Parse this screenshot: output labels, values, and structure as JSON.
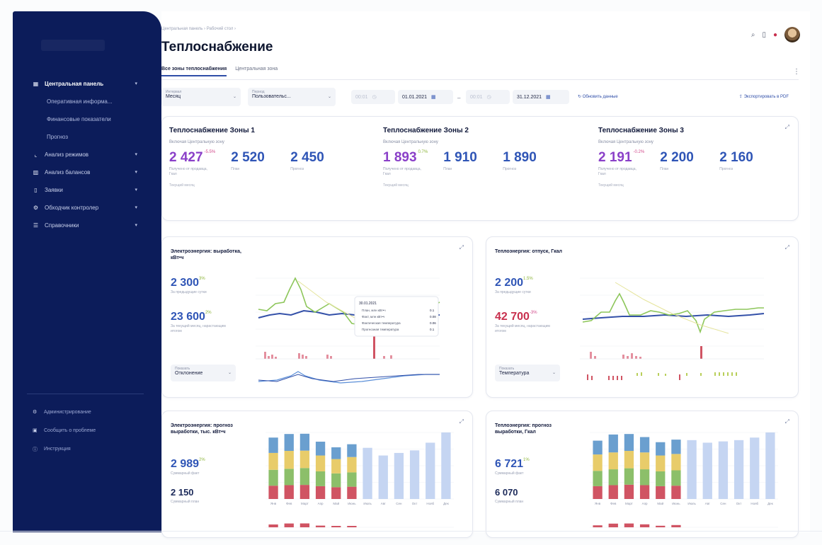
{
  "colors": {
    "sidebar": "#0c1c5a",
    "accent": "#2f55b6",
    "purple": "#8a3fc8",
    "red": "#c8304e",
    "green_line": "#7fc04a",
    "bar_red": "#d05463",
    "bar_green": "#8cbf6a",
    "bar_yellow": "#e8cc6a",
    "bar_blue": "#6a9fcf",
    "bar_forecast": "#c5d5f2"
  },
  "sidebar": {
    "items": [
      {
        "label": "Центральная панель",
        "icon": "grid-icon"
      },
      {
        "label": "Оперативная информа..."
      },
      {
        "label": "Финансовые показатели"
      },
      {
        "label": "Прогноз"
      },
      {
        "label": "Анализ режимов",
        "icon": "chart-line-icon"
      },
      {
        "label": "Анализ балансов",
        "icon": "chart-bar-icon"
      },
      {
        "label": "Заявки",
        "icon": "document-icon"
      },
      {
        "label": "Обходчик контролер",
        "icon": "gear-icon"
      },
      {
        "label": "Справочники",
        "icon": "list-icon"
      }
    ],
    "footer": [
      {
        "label": "Администрирование",
        "icon": "settings-icon"
      },
      {
        "label": "Сообщить о проблеме",
        "icon": "message-icon"
      },
      {
        "label": "Инструкция",
        "icon": "info-icon"
      }
    ]
  },
  "header": {
    "breadcrumb": "Центральная панель  ›  Рабочий стол  ›",
    "title": "Теплоснабжение",
    "tabs": [
      "Все зоны теплоснабжения",
      "Центральная зона"
    ]
  },
  "filters": {
    "interval_label": "Интервал",
    "interval_value": "Месяц",
    "period_label": "Период",
    "period_value": "Пользовательс...",
    "time_from": "00:01",
    "date_from": "01.01.2021",
    "time_to": "00:01",
    "date_to": "31.12.2021",
    "refresh": "Обновить данные",
    "export": "Экспортировать в PDF"
  },
  "zones": [
    {
      "title": "Теплоснабжение Зоны 1",
      "subtitle": "Включая Центральную зону",
      "value": "2 427",
      "delta": "-5.5%",
      "value_label": "Получено от продавца, Гкал",
      "plan": "2 520",
      "plan_label": "План",
      "forecast": "2 450",
      "forecast_label": "Прогноз",
      "footer": "Текущий месяц"
    },
    {
      "title": "Теплоснабжение Зоны 2",
      "subtitle": "Включая Центральную зону",
      "value": "1 893",
      "delta": "0.7%",
      "value_label": "Получено от продавца, Гкал",
      "plan": "1 910",
      "plan_label": "План",
      "forecast": "1 890",
      "forecast_label": "Прогноз",
      "footer": "Текущий месяц"
    },
    {
      "title": "Теплоснабжение Зоны 3",
      "subtitle": "Включая Центральную зону",
      "value": "2 191",
      "delta": "-0.2%",
      "value_label": "Получено от продавца, Гкал",
      "plan": "2 200",
      "plan_label": "План",
      "forecast": "2 160",
      "forecast_label": "Прогноз",
      "footer": "Текущий месяц"
    }
  ],
  "panels": {
    "elec_output": {
      "title": "Электроэнергия: выработка, кВт•ч",
      "kpi1": "2 300",
      "kpi1_delta": "3%",
      "kpi1_label": "За предыдущие сутки",
      "kpi2": "23 600",
      "kpi2_delta": "2%",
      "kpi2_label": "За текущий месяц, нарастающим итогом",
      "select_label": "Показать",
      "select_value": "Отклонение",
      "tooltip": {
        "date": "30.01.2021",
        "rows": [
          {
            "label": "План, млн кВт•ч",
            "value": "0.1"
          },
          {
            "label": "Факт, млн кВт•ч",
            "value": "0.08"
          },
          {
            "label": "Фактическая температура",
            "value": "0.06"
          },
          {
            "label": "Прогнозная температура",
            "value": "0.1"
          }
        ]
      }
    },
    "heat_release": {
      "title": "Теплоэнергия: отпуск, Гкал",
      "kpi1": "2 200",
      "kpi1_delta": "1.5%",
      "kpi1_label": "За предыдущие сутки",
      "kpi2": "42 700",
      "kpi2_delta": "-3%",
      "kpi2_label": "За текущий месяц, нарастающим итогом",
      "select_label": "Показать",
      "select_value": "Температура"
    },
    "elec_forecast": {
      "title": "Электроэнергия: прогноз выработки, тыс. кВт•ч",
      "kpi1": "2 989",
      "kpi1_delta": "2%",
      "kpi1_label": "Суммарный факт",
      "kpi2": "2 150",
      "kpi2_label": "Суммарный план"
    },
    "heat_forecast": {
      "title": "Теплоэнергия: прогноз выработки, Гкал",
      "kpi1": "6 721",
      "kpi1_delta": "1%",
      "kpi1_label": "Суммарный факт",
      "kpi2": "6 070",
      "kpi2_label": "Суммарный план"
    }
  },
  "chart_data": [
    {
      "type": "bar",
      "title": "",
      "categories": [
        "Янв",
        "Фев",
        "Март",
        "Апр",
        "Май",
        "Июнь",
        "Июль",
        "Авг",
        "Сен",
        "Окт",
        "Нояб",
        "Дек"
      ],
      "series": [
        {
          "values": [
            52,
            54,
            55,
            50,
            46,
            48,
            0,
            0,
            0,
            0,
            0,
            0
          ]
        },
        {
          "values": [
            62,
            64,
            66,
            58,
            54,
            56,
            0,
            0,
            0,
            0,
            0,
            0
          ]
        },
        {
          "values": [
            66,
            70,
            68,
            62,
            56,
            60,
            0,
            0,
            0,
            0,
            0,
            0
          ]
        },
        {
          "values": [
            60,
            66,
            66,
            54,
            46,
            50,
            0,
            0,
            0,
            0,
            0,
            0
          ]
        },
        {
          "values": [
            0,
            0,
            0,
            0,
            0,
            0,
            200,
            170,
            180,
            190,
            220,
            260
          ]
        }
      ]
    },
    {
      "type": "bar",
      "title": "",
      "categories": [
        "Янв",
        "Фев",
        "Март",
        "Апр",
        "Май",
        "Июнь",
        "Июль",
        "Авг",
        "Сен",
        "Окт",
        "Нояб",
        "Дек"
      ],
      "series": [
        {
          "values": [
            50,
            54,
            56,
            54,
            50,
            52,
            0,
            0,
            0,
            0,
            0,
            0
          ]
        },
        {
          "values": [
            60,
            62,
            64,
            62,
            58,
            60,
            0,
            0,
            0,
            0,
            0,
            0
          ]
        },
        {
          "values": [
            64,
            66,
            68,
            66,
            62,
            64,
            0,
            0,
            0,
            0,
            0,
            0
          ]
        },
        {
          "values": [
            54,
            70,
            66,
            60,
            52,
            56,
            0,
            0,
            0,
            0,
            0,
            0
          ]
        },
        {
          "values": [
            0,
            0,
            0,
            0,
            0,
            0,
            230,
            220,
            225,
            230,
            240,
            260
          ]
        }
      ]
    }
  ]
}
